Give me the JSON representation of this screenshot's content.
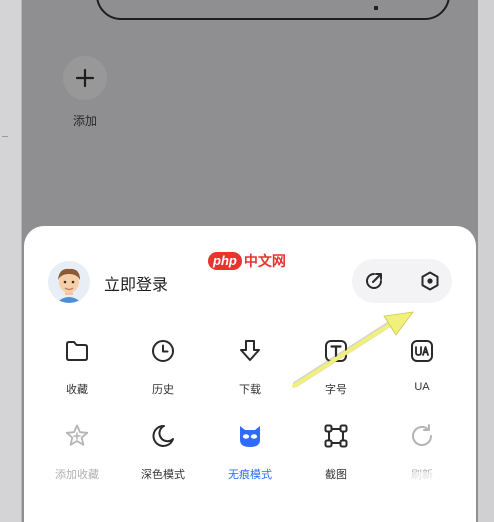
{
  "home": {
    "add_label": "添加"
  },
  "menu": {
    "login_label": "立即登录",
    "watermark": {
      "logo": "php",
      "text": "中文网"
    },
    "top_actions": [
      {
        "icon": "share-icon"
      },
      {
        "icon": "settings-hexagon-icon"
      }
    ],
    "row1": [
      {
        "label": "收藏",
        "icon": "folder-icon"
      },
      {
        "label": "历史",
        "icon": "clock-icon"
      },
      {
        "label": "下载",
        "icon": "download-icon"
      },
      {
        "label": "字号",
        "icon": "font-size-icon"
      },
      {
        "label": "UA",
        "icon": "ua-icon"
      }
    ],
    "row2": [
      {
        "label": "添加收藏",
        "icon": "star-plus-icon",
        "state": "disabled"
      },
      {
        "label": "深色模式",
        "icon": "moon-icon",
        "state": "normal"
      },
      {
        "label": "无痕模式",
        "icon": "incognito-icon",
        "state": "active"
      },
      {
        "label": "截图",
        "icon": "screenshot-icon",
        "state": "normal"
      },
      {
        "label": "刷新",
        "icon": "refresh-icon",
        "state": "disabled"
      }
    ]
  },
  "colors": {
    "accent": "#2f6bff",
    "overlay": "#8f8f91",
    "sheet": "#ffffff",
    "annotation_arrow": "#f1f07a"
  }
}
